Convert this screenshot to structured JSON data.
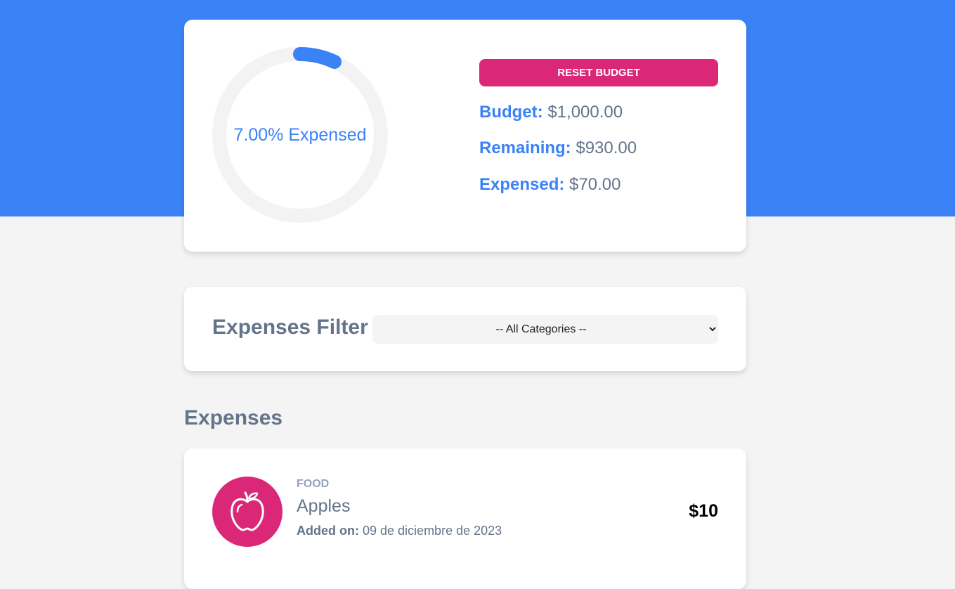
{
  "budget": {
    "progress_percent": 7,
    "progress_label": "7.00% Expensed",
    "reset_label": "Reset Budget",
    "budget_key": "Budget:",
    "budget_value": "$1,000.00",
    "remaining_key": "Remaining:",
    "remaining_value": "$930.00",
    "expensed_key": "Expensed:",
    "expensed_value": "$70.00"
  },
  "filter": {
    "title": "Expenses Filter",
    "selected": "-- All Categories --"
  },
  "expenses": {
    "title": "Expenses",
    "items": [
      {
        "category": "Food",
        "icon": "apple-icon",
        "name": "Apples",
        "date_key": "Added on:",
        "date_value": "09 de diciembre de 2023",
        "amount": "$10"
      }
    ]
  },
  "colors": {
    "header_blue": "#3b82f6",
    "accent_pink": "#db2777",
    "text_slate": "#64748b",
    "ring_track": "#f3f3f3"
  }
}
